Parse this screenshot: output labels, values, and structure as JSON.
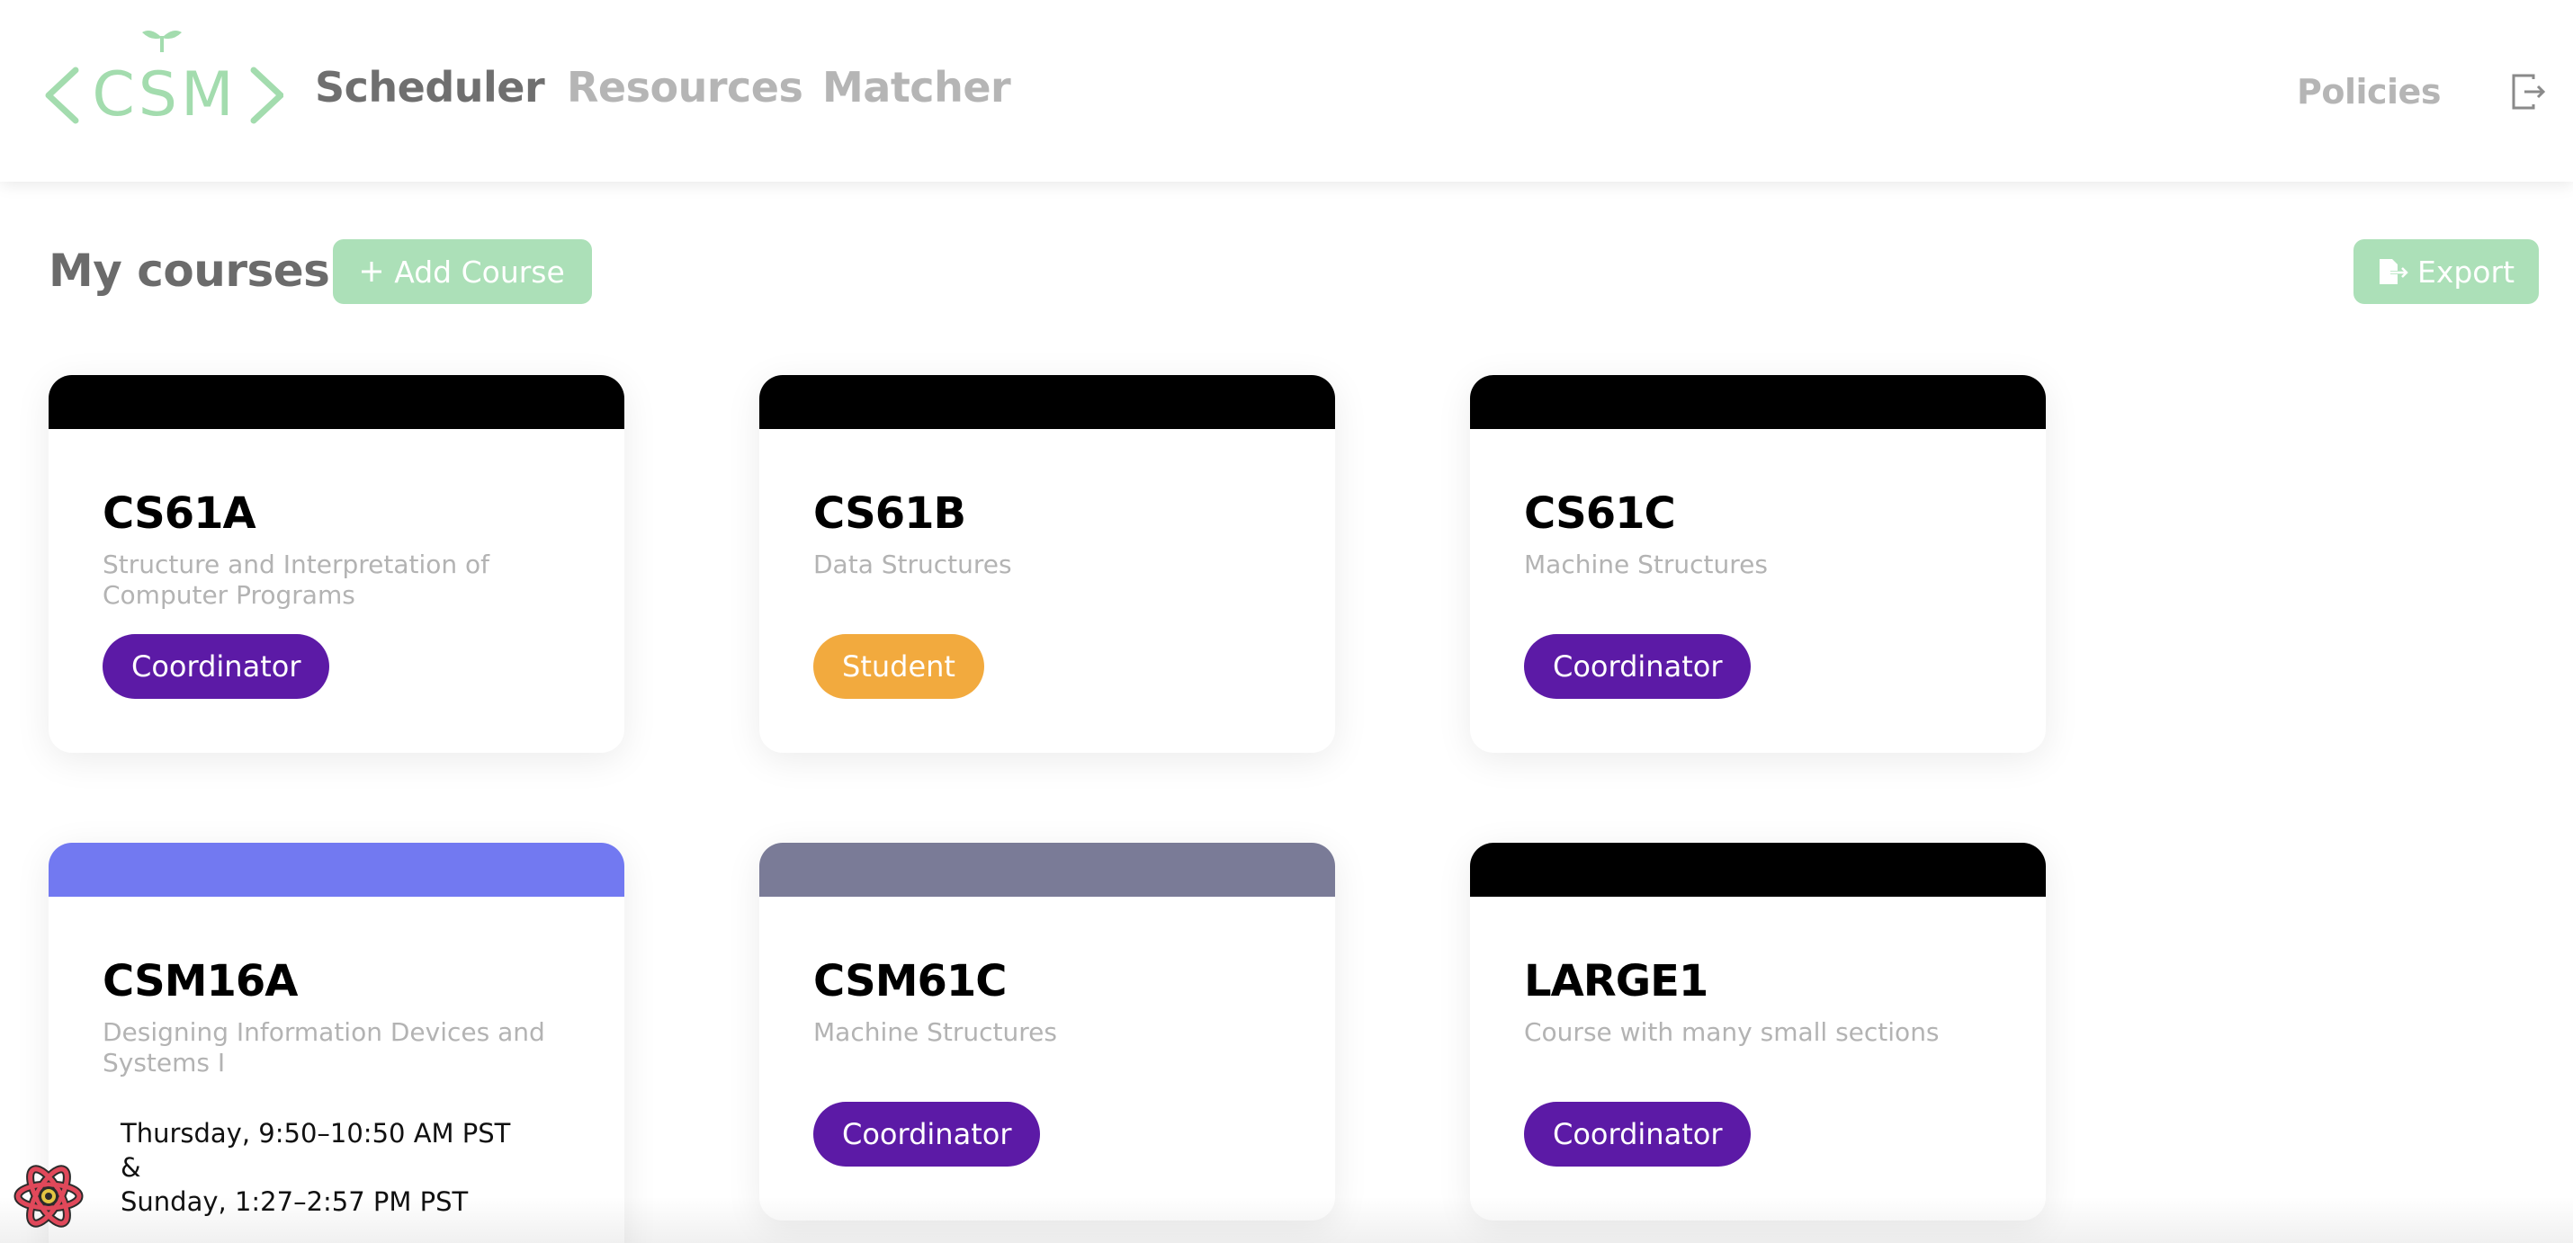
{
  "header": {
    "logo_text": "CSM",
    "logo_color": "#a3dcae",
    "nav": {
      "scheduler": "Scheduler",
      "resources": "Resources",
      "matcher": "Matcher",
      "policies": "Policies"
    },
    "active_tab": "Scheduler"
  },
  "toolbar": {
    "title": "My courses",
    "add_course_label": "Add Course",
    "export_label": "Export"
  },
  "courses": [
    {
      "code": "CS61A",
      "title": "Structure and Interpretation of Computer Programs",
      "role": "Coordinator",
      "bar_color": "#000000"
    },
    {
      "code": "CS61B",
      "title": "Data Structures",
      "role": "Student",
      "bar_color": "#000000"
    },
    {
      "code": "CS61C",
      "title": "Machine Structures",
      "role": "Coordinator",
      "bar_color": "#000000"
    },
    {
      "code": "CSM16A",
      "title": "Designing Information Devices and Systems I",
      "times": [
        "Thursday, 9:50–10:50 AM PST",
        "&",
        "Sunday, 1:27–2:57 PM PST"
      ],
      "bar_color": "#7279f1"
    },
    {
      "code": "CSM61C",
      "title": "Machine Structures",
      "role": "Coordinator",
      "bar_color": "#7a7b97"
    },
    {
      "code": "LARGE1",
      "title": "Course with many small sections",
      "role": "Coordinator",
      "bar_color": "#000000"
    }
  ],
  "colors": {
    "coordinator": "#5c1aa6",
    "student": "#f2aa3e",
    "accent_green": "#ace0b8"
  },
  "icons": {
    "logout": "logout-icon",
    "add": "plus-icon",
    "export": "file-export-icon",
    "devtools": "react-devtools-icon"
  }
}
